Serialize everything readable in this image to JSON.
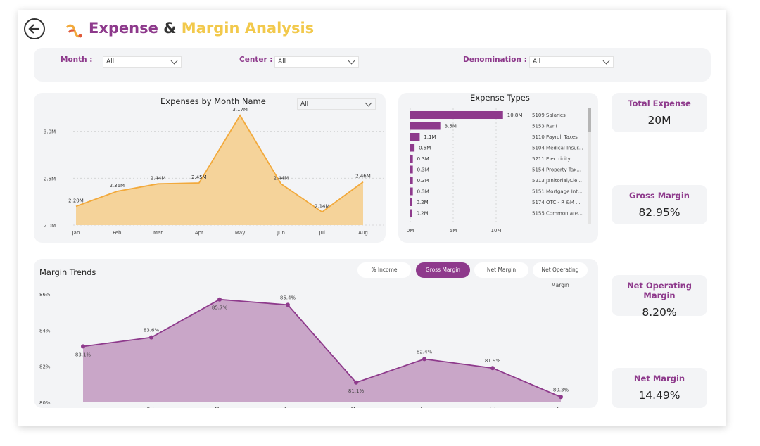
{
  "header": {
    "title_part1": "Expense",
    "title_amp": " & ",
    "title_part2": "Margin Analysis"
  },
  "filters": {
    "month_label": "Month :",
    "month_value": "All",
    "center_label": "Center :",
    "center_value": "All",
    "denomination_label": "Denomination :",
    "denomination_value": "All"
  },
  "expenses_by_month": {
    "title": "Expenses by Month Name",
    "dropdown_value": "All",
    "chart_data": {
      "type": "area",
      "categories": [
        "Jan",
        "Feb",
        "Mar",
        "Apr",
        "May",
        "Jun",
        "Jul",
        "Aug"
      ],
      "values": [
        2.2,
        2.36,
        2.44,
        2.45,
        3.17,
        2.44,
        2.14,
        2.46
      ],
      "data_labels": [
        "2.20M",
        "2.36M",
        "2.44M",
        "2.45M",
        "3.17M",
        "2.44M",
        "2.14M",
        "2.46M"
      ],
      "y_ticks": [
        "2.0M",
        "2.5M",
        "3.0M"
      ],
      "ylim": [
        2.0,
        3.2
      ],
      "color": "#f2a93b"
    }
  },
  "expense_types": {
    "title": "Expense Types",
    "chart_data": {
      "type": "bar",
      "orientation": "horizontal",
      "categories": [
        "5109 Salaries",
        "5153 Rent",
        "5110 Payroll Taxes",
        "5104 Medical Insur...",
        "5211 Electricity",
        "5154 Property Tax...",
        "5213 Janitorial/Cle...",
        "5151 Mortgage Int...",
        "5174 OTC - R &M ...",
        "5155 Common are..."
      ],
      "values": [
        10.8,
        3.5,
        1.1,
        0.5,
        0.3,
        0.3,
        0.3,
        0.3,
        0.2,
        0.2
      ],
      "data_labels": [
        "10.8M",
        "3.5M",
        "1.1M",
        "0.5M",
        "0.3M",
        "0.3M",
        "0.3M",
        "0.3M",
        "0.2M",
        "0.2M"
      ],
      "x_ticks": [
        "0M",
        "5M",
        "10M"
      ],
      "xlim": [
        0,
        10
      ],
      "color": "#8e3a8c"
    }
  },
  "kpis": {
    "total_expense_label": "Total Expense",
    "total_expense_value": "20M",
    "gross_margin_label": "Gross Margin",
    "gross_margin_value": "82.95%",
    "net_operating_margin_label": "Net Operating Margin",
    "net_operating_margin_value": "8.20%",
    "net_margin_label": "Net Margin",
    "net_margin_value": "14.49%"
  },
  "margin_trends": {
    "title": "Margin Trends",
    "buttons": [
      "% Income",
      "Gross Margin",
      "Net Margin",
      "Net Operating Margin"
    ],
    "active_button": "Gross Margin",
    "chart_data": {
      "type": "area",
      "categories": [
        "Jan",
        "Feb",
        "Mar",
        "Apr",
        "May",
        "Jun",
        "Jul",
        "Aug"
      ],
      "values": [
        83.1,
        83.6,
        85.7,
        85.4,
        81.1,
        82.4,
        81.9,
        80.3
      ],
      "data_labels": [
        "83.1%",
        "83.6%",
        "85.7%",
        "85.4%",
        "81.1%",
        "82.4%",
        "81.9%",
        "80.3%"
      ],
      "y_ticks": [
        "80%",
        "82%",
        "84%",
        "86%"
      ],
      "ylim": [
        80,
        86
      ],
      "color": "#8e3a8c"
    }
  }
}
